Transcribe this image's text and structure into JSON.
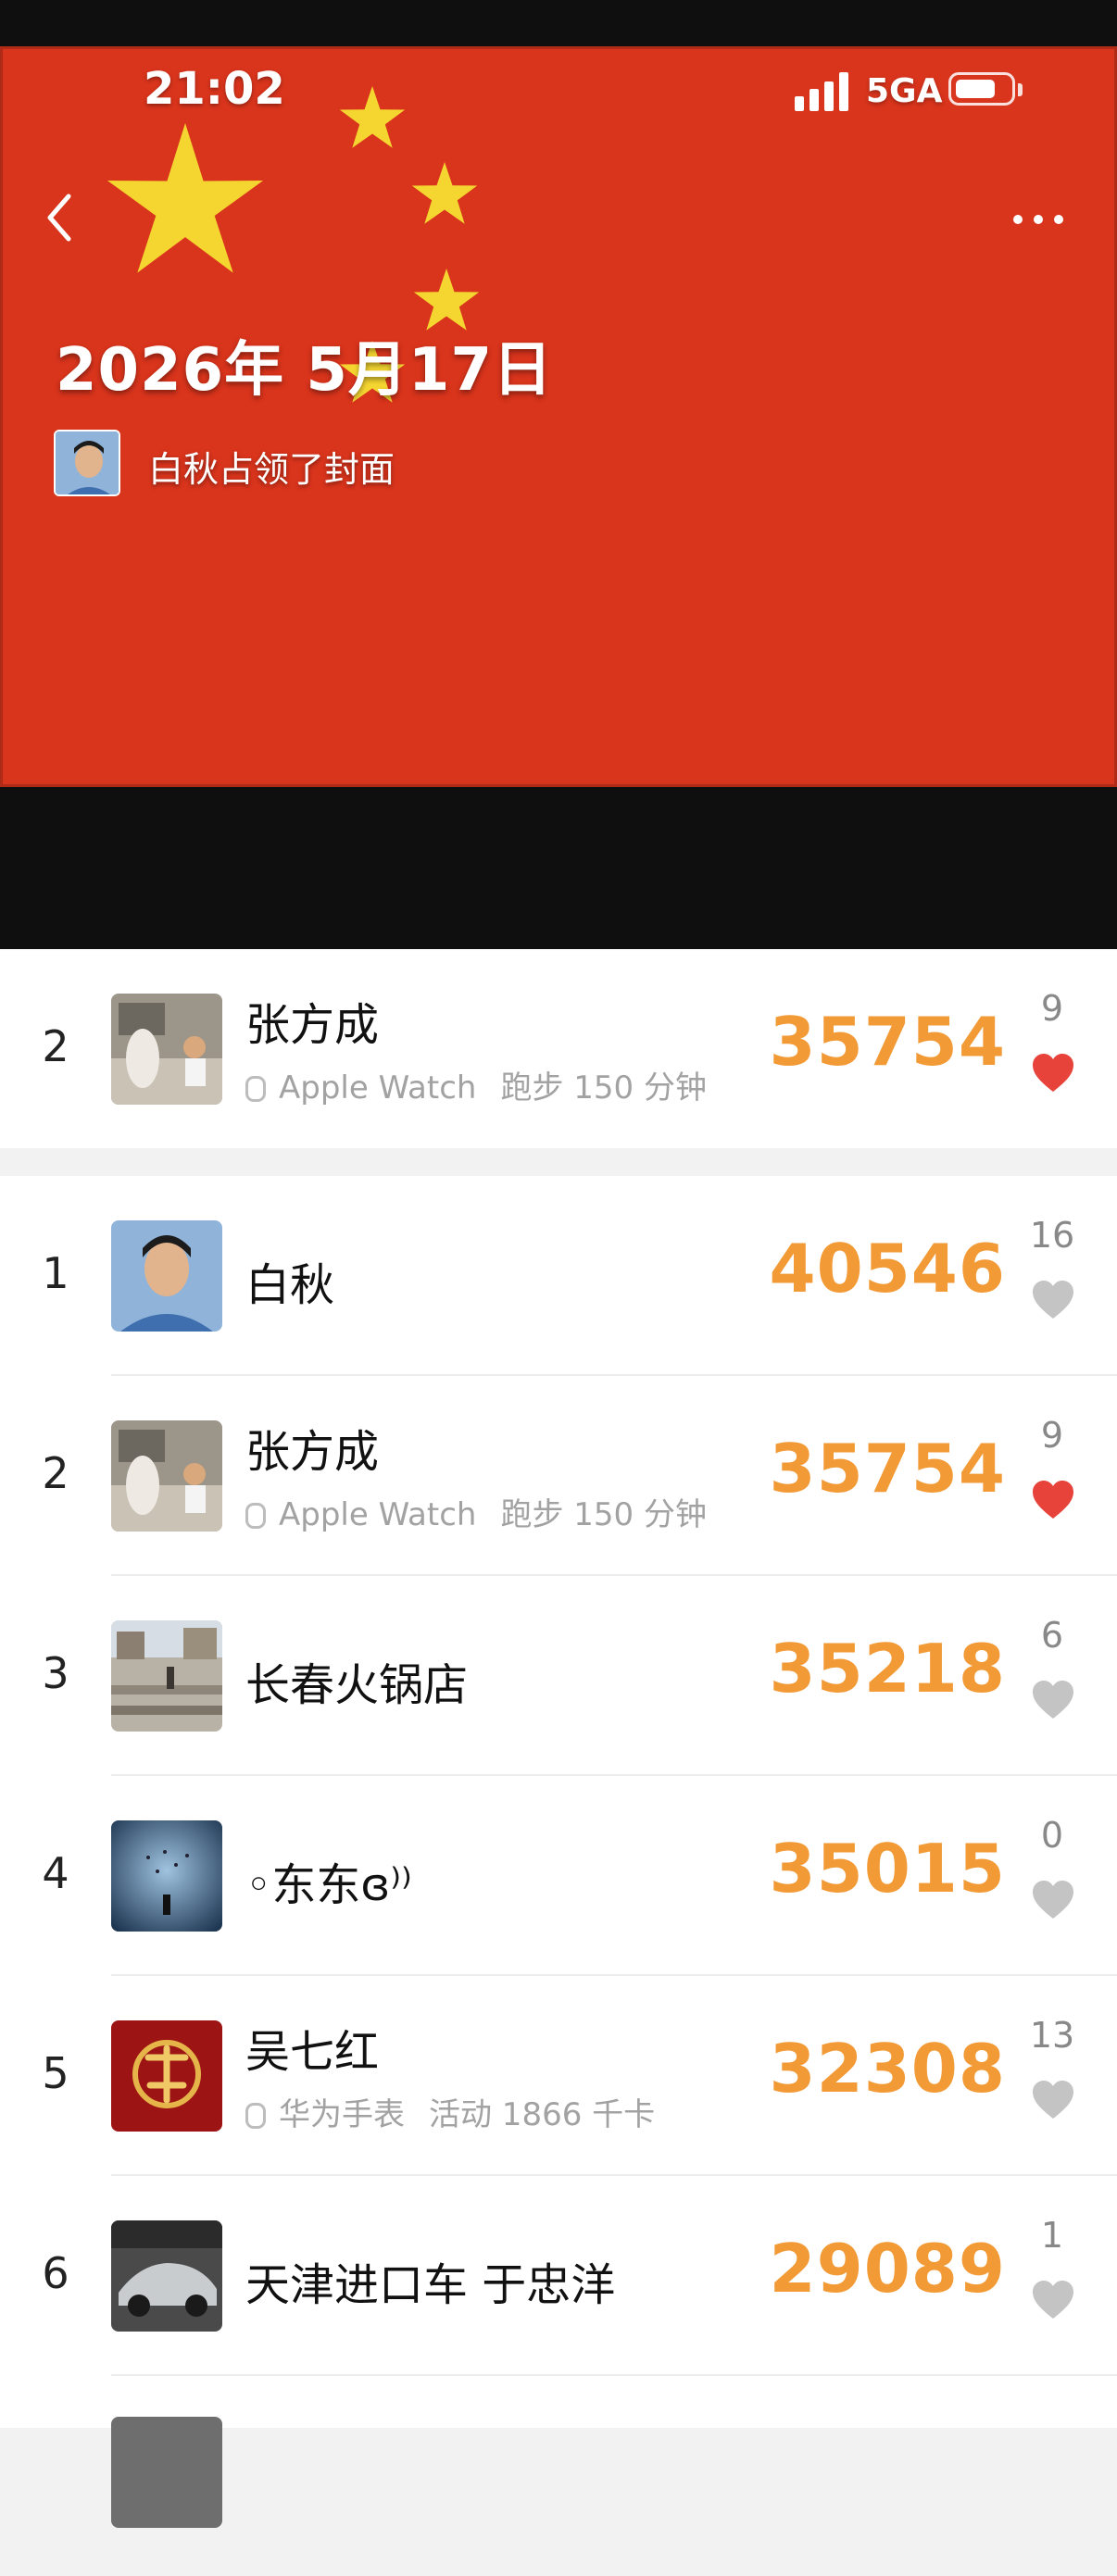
{
  "status_bar": {
    "time": "21:02",
    "network": "5GA"
  },
  "cover": {
    "date": "2026年 5月17日",
    "owner_text": "白秋占领了封面",
    "flag_color": "#d9341c",
    "star_color": "#f5d631"
  },
  "icons": {
    "back": "chevron-left-icon",
    "more": "more-dots-icon",
    "like": "heart-icon",
    "device": "watch-icon"
  },
  "colors": {
    "steps": "#f29a36",
    "liked": "#e8433b",
    "unliked": "#c4c4c4"
  },
  "pinned": {
    "rank": "2",
    "name": "张方成",
    "device": "Apple Watch",
    "activity": "跑步 150 分钟",
    "steps": "35754",
    "likes": "9",
    "liked": true
  },
  "rows": [
    {
      "rank": "1",
      "name": "白秋",
      "steps": "40546",
      "likes": "16",
      "liked": false
    },
    {
      "rank": "2",
      "name": "张方成",
      "device": "Apple Watch",
      "activity": "跑步 150 分钟",
      "steps": "35754",
      "likes": "9",
      "liked": true
    },
    {
      "rank": "3",
      "name": "长春火锅店",
      "steps": "35218",
      "likes": "6",
      "liked": false
    },
    {
      "rank": "4",
      "name": "◦东东ɞ⁾⁾",
      "steps": "35015",
      "likes": "0",
      "liked": false
    },
    {
      "rank": "5",
      "name": "吴七红",
      "device": "华为手表",
      "activity": "活动 1866 千卡",
      "steps": "32308",
      "likes": "13",
      "liked": false
    },
    {
      "rank": "6",
      "name": "天津进口车  于忠洋",
      "steps": "29089",
      "likes": "1",
      "liked": false
    }
  ]
}
